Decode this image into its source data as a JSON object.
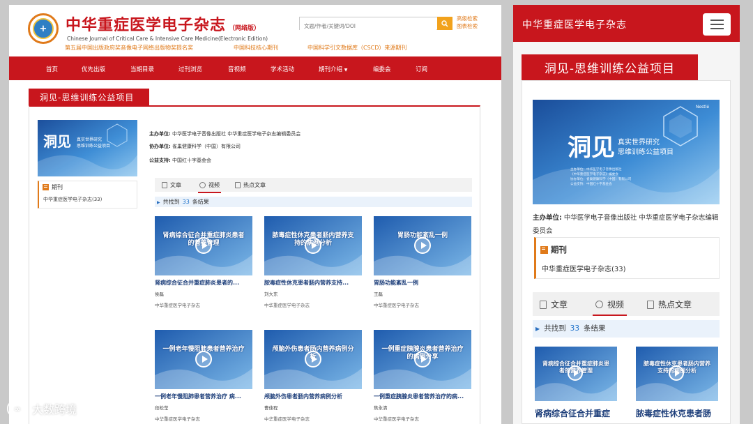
{
  "colors": {
    "brand_red": "#c8161d",
    "accent_orange": "#e07a1a",
    "link_blue": "#1a6fc9",
    "title_navy": "#1d3e7a"
  },
  "site": {
    "title_cn": "中华重症医学电子杂志",
    "title_suffix": "（网络版）",
    "title_en": "Chinese Journal of Critical Care & Intensive Care Medicine(Electronic Edition)",
    "logo_icon": "journal-emblem-icon"
  },
  "search": {
    "placeholder": "文题/作者/关键词/DOI",
    "icon": "search-icon",
    "links": [
      "高级检索",
      "图表检索"
    ]
  },
  "honors": [
    "第五届中国出版政府奖音像电子网络出版物奖提名奖",
    "中国科技核心期刊",
    "中国科学引文数据库（CSCD）来源期刊"
  ],
  "nav": [
    "首页",
    "优先出版",
    "当期目录",
    "过刊浏览",
    "音视频",
    "学术活动",
    "期刊介绍",
    "编委会",
    "订阅"
  ],
  "nav_dropdown_icon": "chevron-down-icon",
  "project": {
    "title": "洞见-思维训练公益项目",
    "banner": {
      "big": "洞见",
      "line1": "真实世界研究",
      "line2": "思维训练公益项目",
      "partner": "Nestlé",
      "small_lines": [
        "主办单位：中华医学电子音像出版社",
        "《中华重症医学电子杂志》编委会",
        "协办单位：雀巢健康科学（中国）有限公司",
        "公益支持：中国红十字基金会"
      ]
    },
    "host_label": "主办单位:",
    "host_value": "中华医学电子音像出版社 中华重症医学电子杂志编辑委员会",
    "co_label": "协办单位:",
    "co_value": "雀巢健康科学（中国）有限公司",
    "support_label": "公益支持:",
    "support_value": "中国红十字基金会"
  },
  "sidebar": {
    "heading": "期刊",
    "icon": "issue-icon",
    "item": "中华重症医学电子杂志(33)"
  },
  "tabs": [
    {
      "label": "文章",
      "icon": "document-icon"
    },
    {
      "label": "视频",
      "icon": "video-icon",
      "active": true
    },
    {
      "label": "热点文章",
      "icon": "hot-article-icon"
    }
  ],
  "results": {
    "prefix": "共找到",
    "count": "33",
    "suffix": "条结果",
    "icon": "double-chevron-right-icon"
  },
  "videos": [
    {
      "thumb_title": "肾病综合征合并重症肺炎患者的营养管理",
      "title": "肾病综合征合并重症肺炎患者的...",
      "author": "侯磊",
      "journal": "中华重症医学电子杂志"
    },
    {
      "thumb_title": "脓毒症性休克患者肠内营养支持的病例分析",
      "title": "脓毒症性休克患者肠内营养支持...",
      "author": "刘大东",
      "journal": "中华重症医学电子杂志"
    },
    {
      "thumb_title": "胃肠功能紊乱一例",
      "title": "胃肠功能紊乱一例",
      "author": "王磊",
      "journal": "中华重症医学电子杂志"
    },
    {
      "thumb_title": "一例老年慢阻肺患者营养治疗",
      "title": "一例老年慢阻肺患者营养治疗 病...",
      "author": "段松莹",
      "journal": "中华重症医学电子杂志"
    },
    {
      "thumb_title": "颅脑外伤患者肠内营养病例分析",
      "title": "颅脑外伤患者肠内营养病例分析",
      "author": "曹佳程",
      "journal": "中华重症医学电子杂志"
    },
    {
      "thumb_title": "一例重症胰腺炎患者营养治疗的病例分享",
      "title": "一例重症胰腺炎患者营养治疗的病...",
      "author": "焦永清",
      "journal": "中华重症医学电子杂志"
    }
  ],
  "mobile": {
    "brand": "中华重症医学电子杂志",
    "menu_icon": "hamburger-menu-icon",
    "title": "洞见-思维训练公益项目",
    "host_label": "主办单位:",
    "host_value": "中华医学电子音像出版社 中华重症医学电子杂志编辑委员会",
    "cards": [
      "肾病综合征合并重症",
      "脓毒症性休克患者肠"
    ]
  },
  "watermark": {
    "text": "大数跨境",
    "icon": "watermark-logo-icon"
  }
}
